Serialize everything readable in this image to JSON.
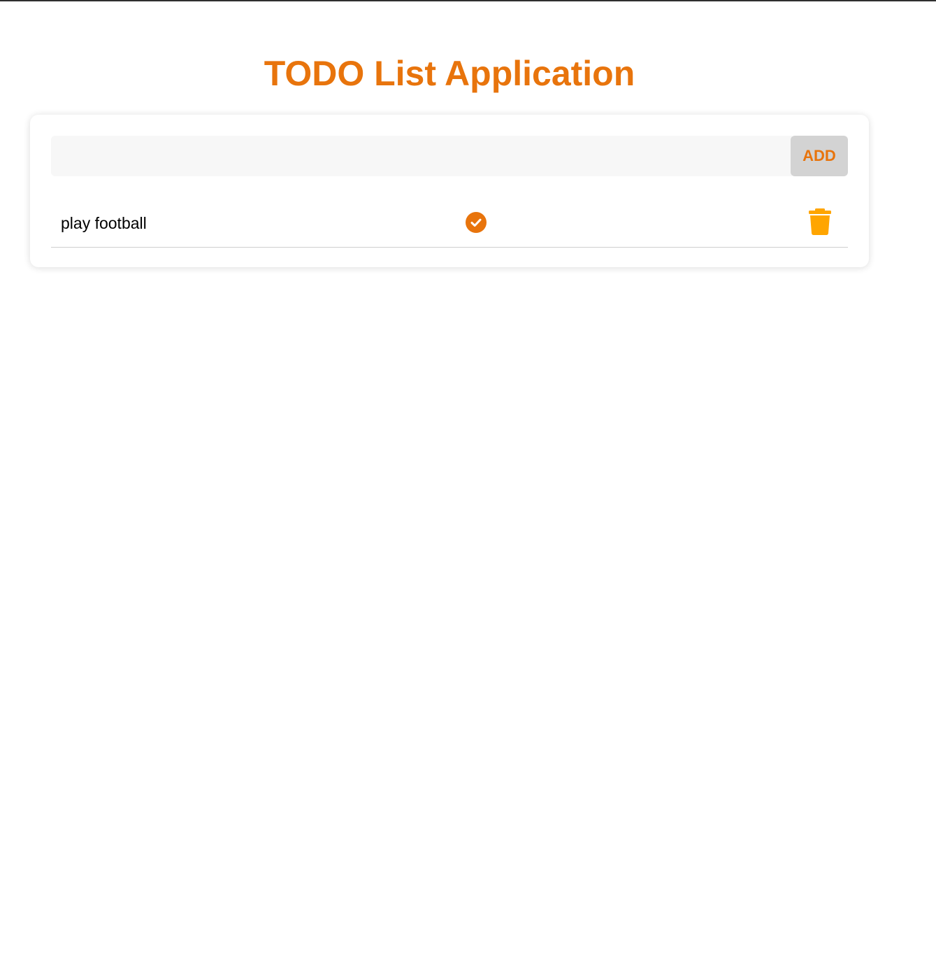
{
  "app": {
    "title": "TODO List Application"
  },
  "form": {
    "input_value": "",
    "input_placeholder": "",
    "add_label": "ADD"
  },
  "todos": [
    {
      "text": "play football",
      "complete_icon": "check-circle-icon",
      "delete_icon": "trash-icon"
    }
  ],
  "colors": {
    "accent": "#e8740c",
    "delete": "#ffa500",
    "button_bg": "#d3d3d3",
    "input_bg": "#f7f7f7"
  }
}
